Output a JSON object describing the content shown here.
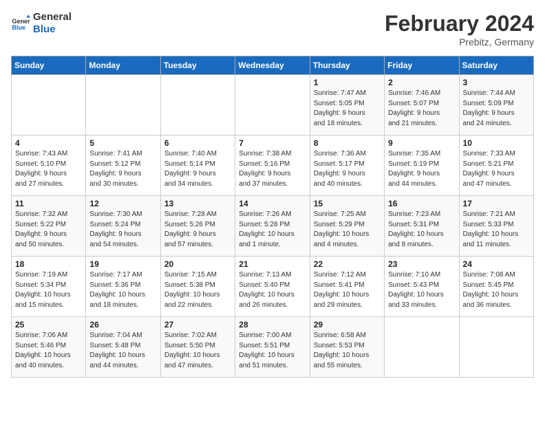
{
  "header": {
    "logo_general": "General",
    "logo_blue": "Blue",
    "month_title": "February 2024",
    "subtitle": "Prebitz, Germany"
  },
  "weekdays": [
    "Sunday",
    "Monday",
    "Tuesday",
    "Wednesday",
    "Thursday",
    "Friday",
    "Saturday"
  ],
  "weeks": [
    [
      {
        "day": "",
        "info": ""
      },
      {
        "day": "",
        "info": ""
      },
      {
        "day": "",
        "info": ""
      },
      {
        "day": "",
        "info": ""
      },
      {
        "day": "1",
        "info": "Sunrise: 7:47 AM\nSunset: 5:05 PM\nDaylight: 9 hours\nand 18 minutes."
      },
      {
        "day": "2",
        "info": "Sunrise: 7:46 AM\nSunset: 5:07 PM\nDaylight: 9 hours\nand 21 minutes."
      },
      {
        "day": "3",
        "info": "Sunrise: 7:44 AM\nSunset: 5:09 PM\nDaylight: 9 hours\nand 24 minutes."
      }
    ],
    [
      {
        "day": "4",
        "info": "Sunrise: 7:43 AM\nSunset: 5:10 PM\nDaylight: 9 hours\nand 27 minutes."
      },
      {
        "day": "5",
        "info": "Sunrise: 7:41 AM\nSunset: 5:12 PM\nDaylight: 9 hours\nand 30 minutes."
      },
      {
        "day": "6",
        "info": "Sunrise: 7:40 AM\nSunset: 5:14 PM\nDaylight: 9 hours\nand 34 minutes."
      },
      {
        "day": "7",
        "info": "Sunrise: 7:38 AM\nSunset: 5:16 PM\nDaylight: 9 hours\nand 37 minutes."
      },
      {
        "day": "8",
        "info": "Sunrise: 7:36 AM\nSunset: 5:17 PM\nDaylight: 9 hours\nand 40 minutes."
      },
      {
        "day": "9",
        "info": "Sunrise: 7:35 AM\nSunset: 5:19 PM\nDaylight: 9 hours\nand 44 minutes."
      },
      {
        "day": "10",
        "info": "Sunrise: 7:33 AM\nSunset: 5:21 PM\nDaylight: 9 hours\nand 47 minutes."
      }
    ],
    [
      {
        "day": "11",
        "info": "Sunrise: 7:32 AM\nSunset: 5:22 PM\nDaylight: 9 hours\nand 50 minutes."
      },
      {
        "day": "12",
        "info": "Sunrise: 7:30 AM\nSunset: 5:24 PM\nDaylight: 9 hours\nand 54 minutes."
      },
      {
        "day": "13",
        "info": "Sunrise: 7:28 AM\nSunset: 5:26 PM\nDaylight: 9 hours\nand 57 minutes."
      },
      {
        "day": "14",
        "info": "Sunrise: 7:26 AM\nSunset: 5:28 PM\nDaylight: 10 hours\nand 1 minute."
      },
      {
        "day": "15",
        "info": "Sunrise: 7:25 AM\nSunset: 5:29 PM\nDaylight: 10 hours\nand 4 minutes."
      },
      {
        "day": "16",
        "info": "Sunrise: 7:23 AM\nSunset: 5:31 PM\nDaylight: 10 hours\nand 8 minutes."
      },
      {
        "day": "17",
        "info": "Sunrise: 7:21 AM\nSunset: 5:33 PM\nDaylight: 10 hours\nand 11 minutes."
      }
    ],
    [
      {
        "day": "18",
        "info": "Sunrise: 7:19 AM\nSunset: 5:34 PM\nDaylight: 10 hours\nand 15 minutes."
      },
      {
        "day": "19",
        "info": "Sunrise: 7:17 AM\nSunset: 5:36 PM\nDaylight: 10 hours\nand 18 minutes."
      },
      {
        "day": "20",
        "info": "Sunrise: 7:15 AM\nSunset: 5:38 PM\nDaylight: 10 hours\nand 22 minutes."
      },
      {
        "day": "21",
        "info": "Sunrise: 7:13 AM\nSunset: 5:40 PM\nDaylight: 10 hours\nand 26 minutes."
      },
      {
        "day": "22",
        "info": "Sunrise: 7:12 AM\nSunset: 5:41 PM\nDaylight: 10 hours\nand 29 minutes."
      },
      {
        "day": "23",
        "info": "Sunrise: 7:10 AM\nSunset: 5:43 PM\nDaylight: 10 hours\nand 33 minutes."
      },
      {
        "day": "24",
        "info": "Sunrise: 7:08 AM\nSunset: 5:45 PM\nDaylight: 10 hours\nand 36 minutes."
      }
    ],
    [
      {
        "day": "25",
        "info": "Sunrise: 7:06 AM\nSunset: 5:46 PM\nDaylight: 10 hours\nand 40 minutes."
      },
      {
        "day": "26",
        "info": "Sunrise: 7:04 AM\nSunset: 5:48 PM\nDaylight: 10 hours\nand 44 minutes."
      },
      {
        "day": "27",
        "info": "Sunrise: 7:02 AM\nSunset: 5:50 PM\nDaylight: 10 hours\nand 47 minutes."
      },
      {
        "day": "28",
        "info": "Sunrise: 7:00 AM\nSunset: 5:51 PM\nDaylight: 10 hours\nand 51 minutes."
      },
      {
        "day": "29",
        "info": "Sunrise: 6:58 AM\nSunset: 5:53 PM\nDaylight: 10 hours\nand 55 minutes."
      },
      {
        "day": "",
        "info": ""
      },
      {
        "day": "",
        "info": ""
      }
    ]
  ]
}
